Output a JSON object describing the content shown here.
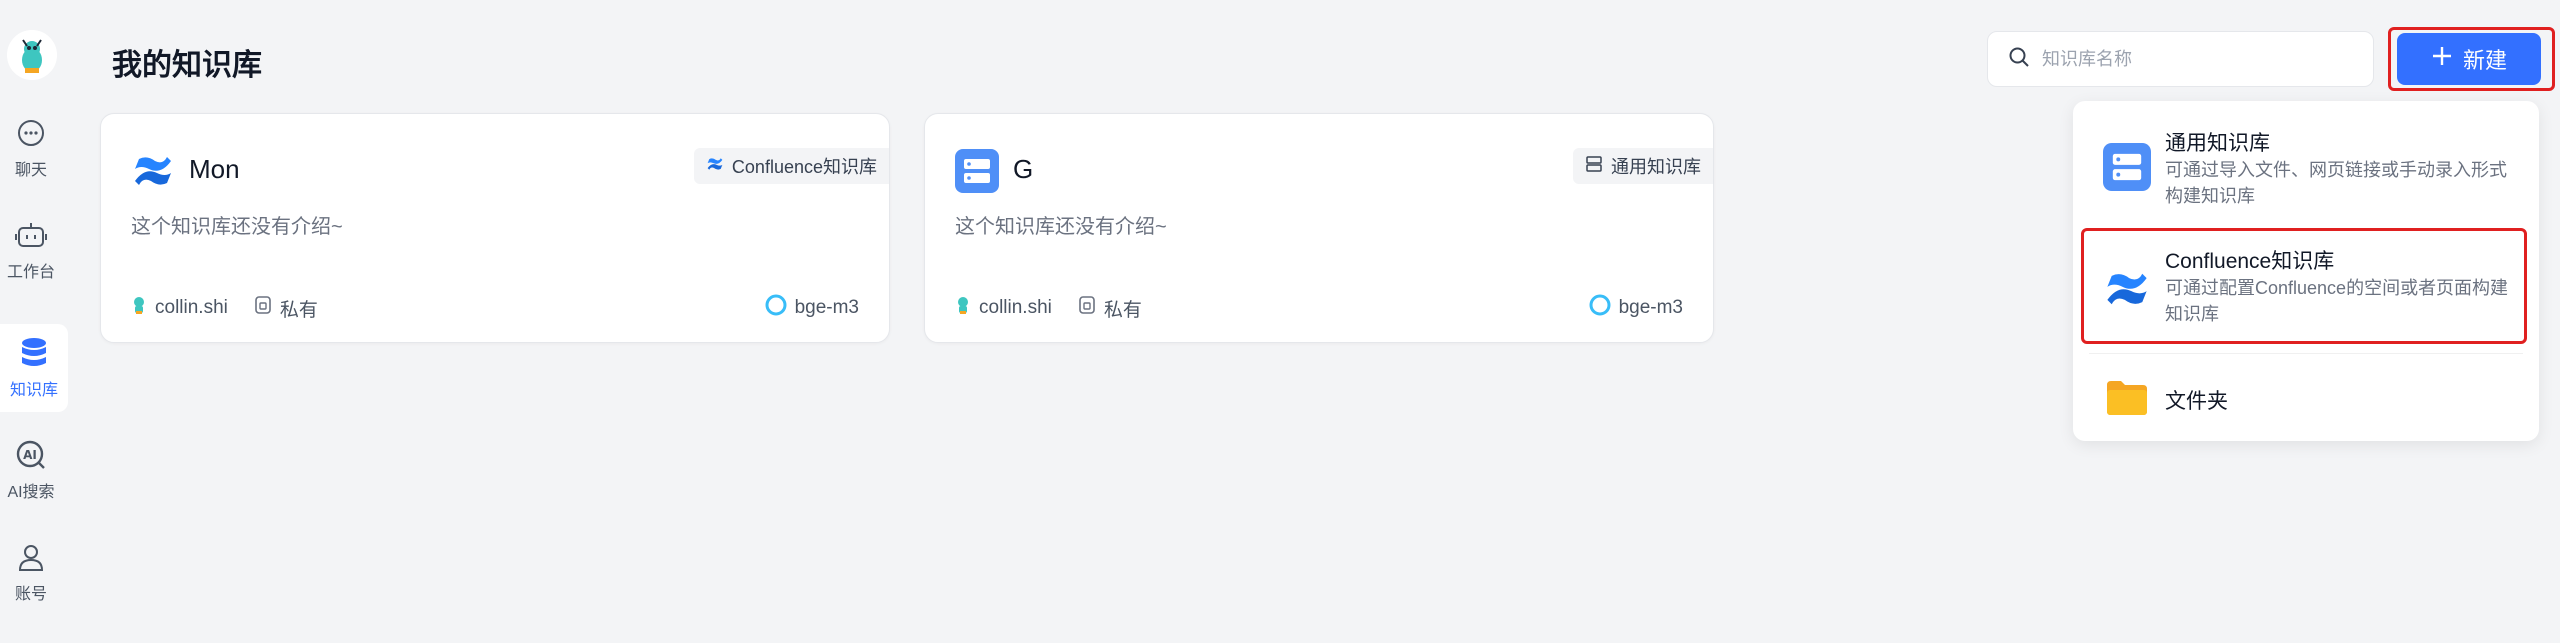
{
  "sidebar": {
    "items": [
      {
        "label": "聊天",
        "icon": "chat-icon"
      },
      {
        "label": "工作台",
        "icon": "robot-icon"
      },
      {
        "label": "知识库",
        "icon": "database-icon",
        "active": true
      },
      {
        "label": "AI搜索",
        "icon": "ai-search-icon"
      },
      {
        "label": "账号",
        "icon": "user-icon"
      }
    ]
  },
  "header": {
    "title": "我的知识库",
    "search_placeholder": "知识库名称",
    "new_label": "新建"
  },
  "cards": [
    {
      "title": "Mon",
      "tag": "Confluence知识库",
      "intro": "这个知识库还没有介绍~",
      "owner": "collin.shi",
      "visibility": "私有",
      "model": "bge-m3"
    },
    {
      "title": "G",
      "tag": "通用知识库",
      "intro": "这个知识库还没有介绍~",
      "owner": "collin.shi",
      "visibility": "私有",
      "model": "bge-m3"
    }
  ],
  "dropdown": {
    "items": [
      {
        "title": "通用知识库",
        "desc": "可通过导入文件、网页链接或手动录入形式构建知识库"
      },
      {
        "title": "Confluence知识库",
        "desc": "可通过配置Confluence的空间或者页面构建知识库"
      },
      {
        "title": "文件夹",
        "desc": ""
      }
    ]
  },
  "colors": {
    "accent": "#3370ff",
    "highlight": "#e02020",
    "folder": "#f5a623"
  }
}
